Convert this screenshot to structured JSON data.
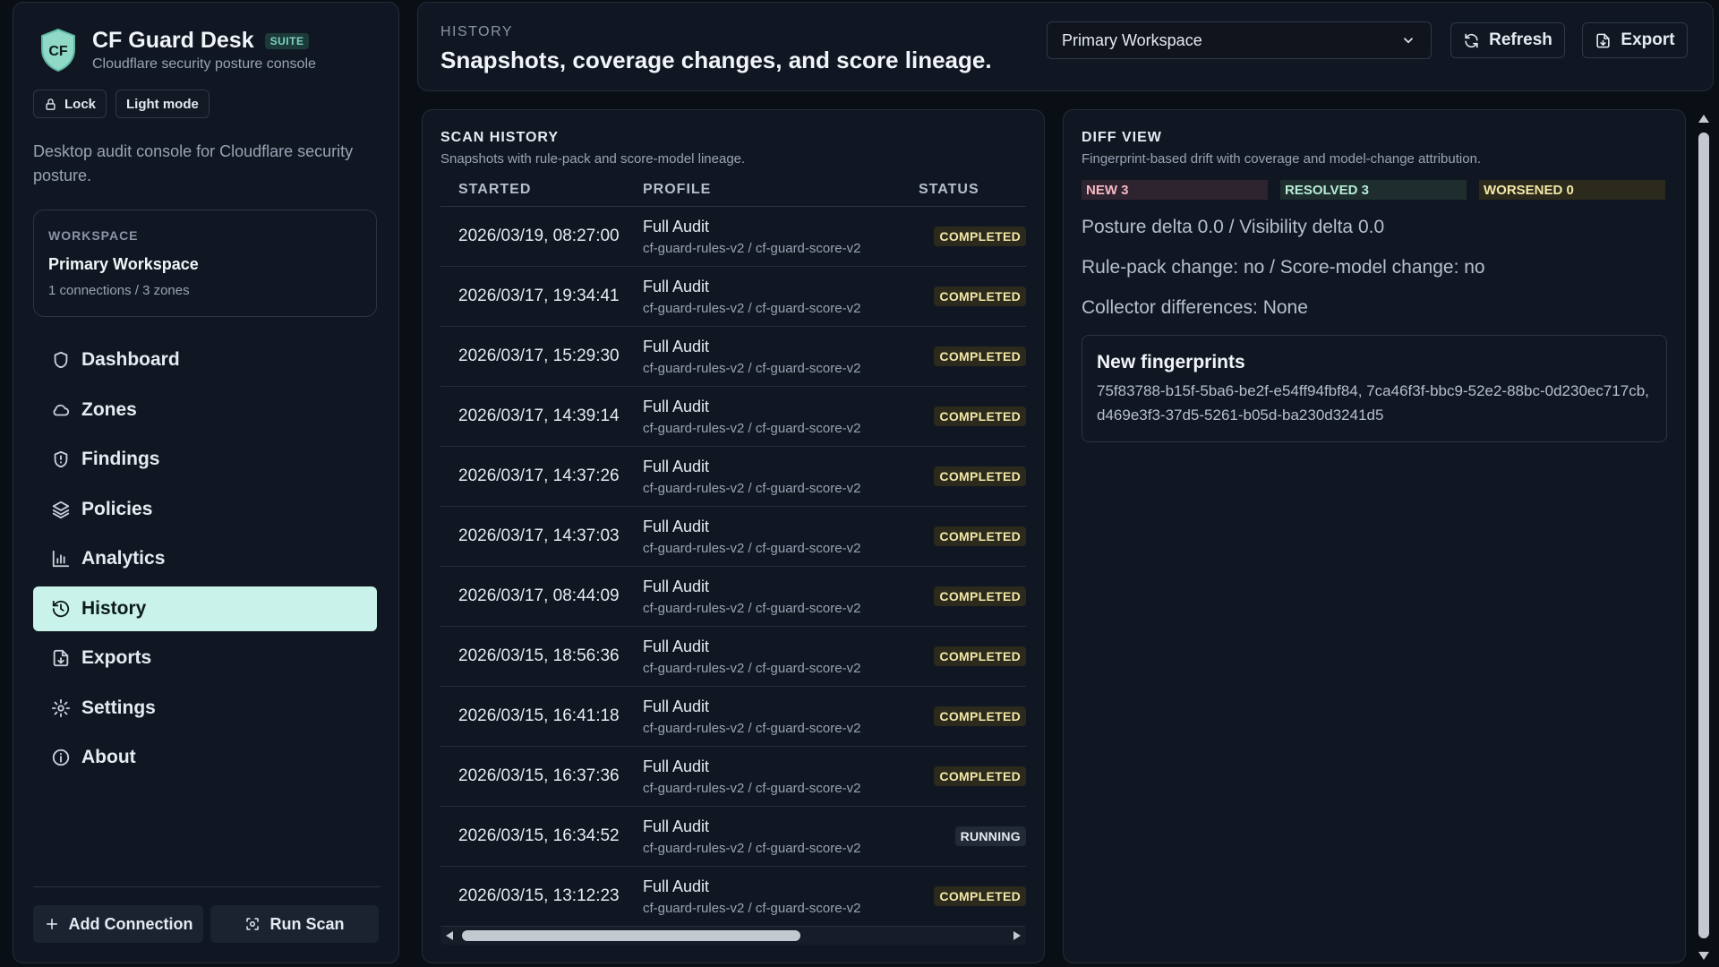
{
  "app": {
    "title": "CF Guard Desk",
    "badge": "SUITE",
    "subtitle": "Cloudflare security posture console",
    "logo_text": "CF",
    "description": "Desktop audit console for Cloudflare security posture."
  },
  "controls": {
    "lock": "Lock",
    "light_mode": "Light mode"
  },
  "workspace": {
    "label": "WORKSPACE",
    "name": "Primary Workspace",
    "meta": "1 connections / 3 zones"
  },
  "nav": {
    "items": [
      {
        "label": "Dashboard",
        "icon": "shield-icon"
      },
      {
        "label": "Zones",
        "icon": "cloud-icon"
      },
      {
        "label": "Findings",
        "icon": "shield-alert-icon"
      },
      {
        "label": "Policies",
        "icon": "layers-icon"
      },
      {
        "label": "Analytics",
        "icon": "bar-chart-icon"
      },
      {
        "label": "History",
        "icon": "history-icon",
        "active": true
      },
      {
        "label": "Exports",
        "icon": "file-export-icon"
      },
      {
        "label": "Settings",
        "icon": "gear-icon"
      },
      {
        "label": "About",
        "icon": "info-icon"
      }
    ]
  },
  "actions": {
    "add_connection": "Add Connection",
    "run_scan": "Run Scan"
  },
  "header": {
    "section_label": "HISTORY",
    "title": "Snapshots, coverage changes, and score lineage.",
    "workspace_select": "Primary Workspace",
    "refresh": "Refresh",
    "export": "Export"
  },
  "scan_history": {
    "title": "SCAN HISTORY",
    "subtitle": "Snapshots with rule-pack and score-model lineage.",
    "columns": {
      "started": "STARTED",
      "profile": "PROFILE",
      "status": "STATUS"
    },
    "rows": [
      {
        "started": "2026/03/19, 08:27:00",
        "profile": "Full Audit",
        "lineage": "cf-guard-rules-v2 / cf-guard-score-v2",
        "status": "COMPLETED"
      },
      {
        "started": "2026/03/17, 19:34:41",
        "profile": "Full Audit",
        "lineage": "cf-guard-rules-v2 / cf-guard-score-v2",
        "status": "COMPLETED"
      },
      {
        "started": "2026/03/17, 15:29:30",
        "profile": "Full Audit",
        "lineage": "cf-guard-rules-v2 / cf-guard-score-v2",
        "status": "COMPLETED"
      },
      {
        "started": "2026/03/17, 14:39:14",
        "profile": "Full Audit",
        "lineage": "cf-guard-rules-v2 / cf-guard-score-v2",
        "status": "COMPLETED"
      },
      {
        "started": "2026/03/17, 14:37:26",
        "profile": "Full Audit",
        "lineage": "cf-guard-rules-v2 / cf-guard-score-v2",
        "status": "COMPLETED"
      },
      {
        "started": "2026/03/17, 14:37:03",
        "profile": "Full Audit",
        "lineage": "cf-guard-rules-v2 / cf-guard-score-v2",
        "status": "COMPLETED"
      },
      {
        "started": "2026/03/17, 08:44:09",
        "profile": "Full Audit",
        "lineage": "cf-guard-rules-v2 / cf-guard-score-v2",
        "status": "COMPLETED"
      },
      {
        "started": "2026/03/15, 18:56:36",
        "profile": "Full Audit",
        "lineage": "cf-guard-rules-v2 / cf-guard-score-v2",
        "status": "COMPLETED"
      },
      {
        "started": "2026/03/15, 16:41:18",
        "profile": "Full Audit",
        "lineage": "cf-guard-rules-v2 / cf-guard-score-v2",
        "status": "COMPLETED"
      },
      {
        "started": "2026/03/15, 16:37:36",
        "profile": "Full Audit",
        "lineage": "cf-guard-rules-v2 / cf-guard-score-v2",
        "status": "COMPLETED"
      },
      {
        "started": "2026/03/15, 16:34:52",
        "profile": "Full Audit",
        "lineage": "cf-guard-rules-v2 / cf-guard-score-v2",
        "status": "RUNNING"
      },
      {
        "started": "2026/03/15, 13:12:23",
        "profile": "Full Audit",
        "lineage": "cf-guard-rules-v2 / cf-guard-score-v2",
        "status": "COMPLETED"
      }
    ]
  },
  "diff": {
    "title": "DIFF VIEW",
    "subtitle": "Fingerprint-based drift with coverage and model-change attribution.",
    "badges": {
      "new": "NEW 3",
      "resolved": "RESOLVED 3",
      "worsened": "WORSENED 0"
    },
    "posture_line": "Posture delta 0.0 / Visibility delta 0.0",
    "change_line": "Rule-pack change: no / Score-model change: no",
    "collector_line": "Collector differences: None",
    "fingerprints_title": "New fingerprints",
    "fingerprints": "75f83788-b15f-5ba6-be2f-e54ff94fbf84, 7ca46f3f-bbc9-52e2-88bc-0d230ec717cb, d469e3f3-37d5-5261-b05d-ba230d3241d5"
  },
  "colors": {
    "accent": "#c9f3ea",
    "background": "#0a0e15",
    "panel": "#111722",
    "completed_badge": "#f3e8a8",
    "new_badge": "#f7b8c4",
    "resolved_badge": "#b6ecd6"
  }
}
